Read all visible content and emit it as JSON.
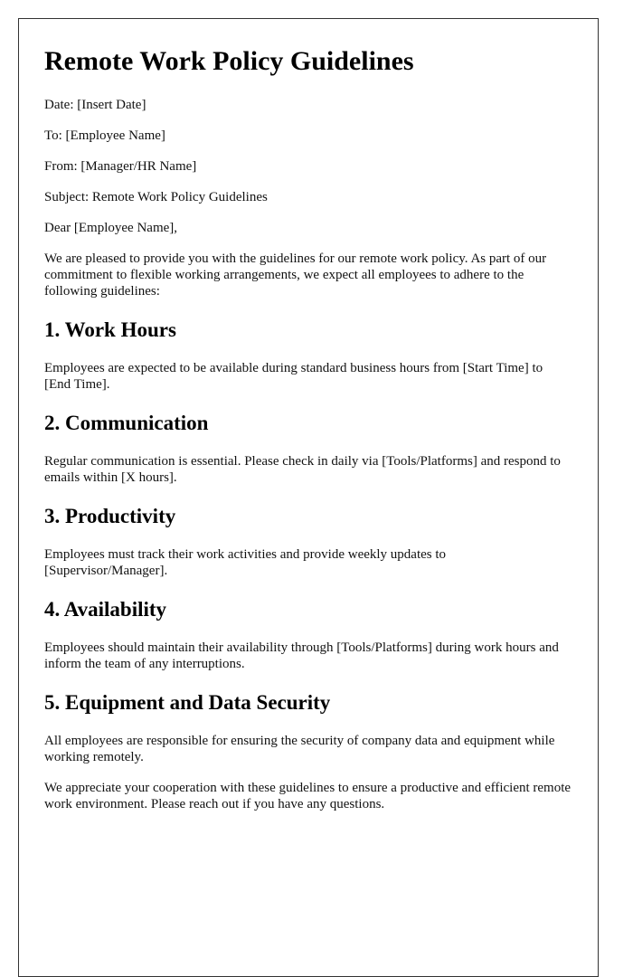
{
  "document": {
    "title": "Remote Work Policy Guidelines",
    "header_fields": [
      {
        "text": "Date: [Insert Date]"
      },
      {
        "text": "To: [Employee Name]"
      },
      {
        "text": "From: [Manager/HR Name]"
      },
      {
        "text": "Subject: Remote Work Policy Guidelines"
      }
    ],
    "salutation": "Dear [Employee Name],",
    "intro": "We are pleased to provide you with the guidelines for our remote work policy. As part of our commitment to flexible working arrangements, we expect all employees to adhere to the following guidelines:",
    "sections": [
      {
        "heading": "1. Work Hours",
        "body": "Employees are expected to be available during standard business hours from [Start Time] to [End Time]."
      },
      {
        "heading": "2. Communication",
        "body": "Regular communication is essential. Please check in daily via [Tools/Platforms] and respond to emails within [X hours]."
      },
      {
        "heading": "3. Productivity",
        "body": "Employees must track their work activities and provide weekly updates to [Supervisor/Manager]."
      },
      {
        "heading": "4. Availability",
        "body": "Employees should maintain their availability through [Tools/Platforms] during work hours and inform the team of any interruptions."
      },
      {
        "heading": "5. Equipment and Data Security",
        "body": "All employees are responsible for ensuring the security of company data and equipment while working remotely."
      }
    ],
    "closing": "We appreciate your cooperation with these guidelines to ensure a productive and efficient remote work environment. Please reach out if you have any questions."
  }
}
